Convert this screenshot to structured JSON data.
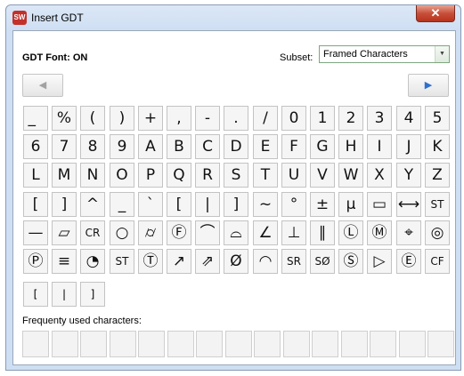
{
  "window": {
    "title": "Insert GDT",
    "close_glyph": "✕",
    "app_icon_text": "SW"
  },
  "font_status": {
    "label": "GDT Font:",
    "value": "ON"
  },
  "subset": {
    "label": "Subset:",
    "value": "Framed Characters",
    "arrow": "▼"
  },
  "nav": {
    "prev_glyph": "◀",
    "next_glyph": "▶"
  },
  "characters": [
    [
      "̲",
      "%",
      "(",
      ")",
      "+",
      ",",
      "-",
      ".",
      "/",
      "0",
      "1",
      "2",
      "3",
      "4",
      "5"
    ],
    [
      "6",
      "7",
      "8",
      "9",
      "A",
      "B",
      "C",
      "D",
      "E",
      "F",
      "G",
      "H",
      "I",
      "J",
      "K"
    ],
    [
      "L",
      "M",
      "N",
      "O",
      "P",
      "Q",
      "R",
      "S",
      "T",
      "U",
      "V",
      "W",
      "X",
      "Y",
      "Z"
    ],
    [
      "[",
      "]",
      "^",
      "_",
      "`",
      "[",
      "|",
      "]",
      "~",
      "°",
      "±",
      "µ",
      "▭",
      "⟷",
      "ST"
    ],
    [
      "—",
      "▱",
      "CR",
      "○",
      "⌭",
      "Ⓕ",
      "⌒",
      "⌓",
      "∠",
      "⊥",
      "∥",
      "Ⓛ",
      "Ⓜ",
      "⌖",
      "◎"
    ],
    [
      "Ⓟ",
      "≡",
      "◔",
      "ST",
      "Ⓣ",
      "↗",
      "⇗",
      "Ø",
      "◠",
      "SR",
      "SØ",
      "Ⓢ",
      "▷",
      "Ⓔ",
      "CF"
    ]
  ],
  "bottom_row": [
    "[",
    "|",
    "]"
  ],
  "frequent": {
    "label": "Frequenty used characters:",
    "slots": 15
  }
}
